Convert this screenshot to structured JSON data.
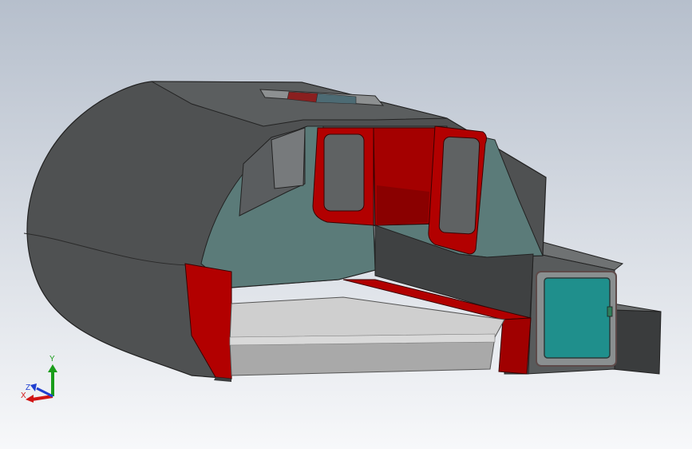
{
  "viewport": {
    "background_top": "#b6bfcc",
    "background_bottom": "#f7f8fa",
    "model": "teardrop-trailer-cutaway"
  },
  "colors": {
    "shell_dark": "#4b4d4e",
    "shell_mid": "#5f6263",
    "interior_wall": "#5d7a78",
    "red": "#b20000",
    "red_dark": "#7c0000",
    "mattress": "#c9c9c9",
    "door_window": "#1f8f8c"
  },
  "triad": {
    "x_label": "X",
    "y_label": "Y",
    "z_label": "Z",
    "x_color": "#d11414",
    "y_color": "#1a9d1a",
    "z_color": "#1f3fd0"
  }
}
